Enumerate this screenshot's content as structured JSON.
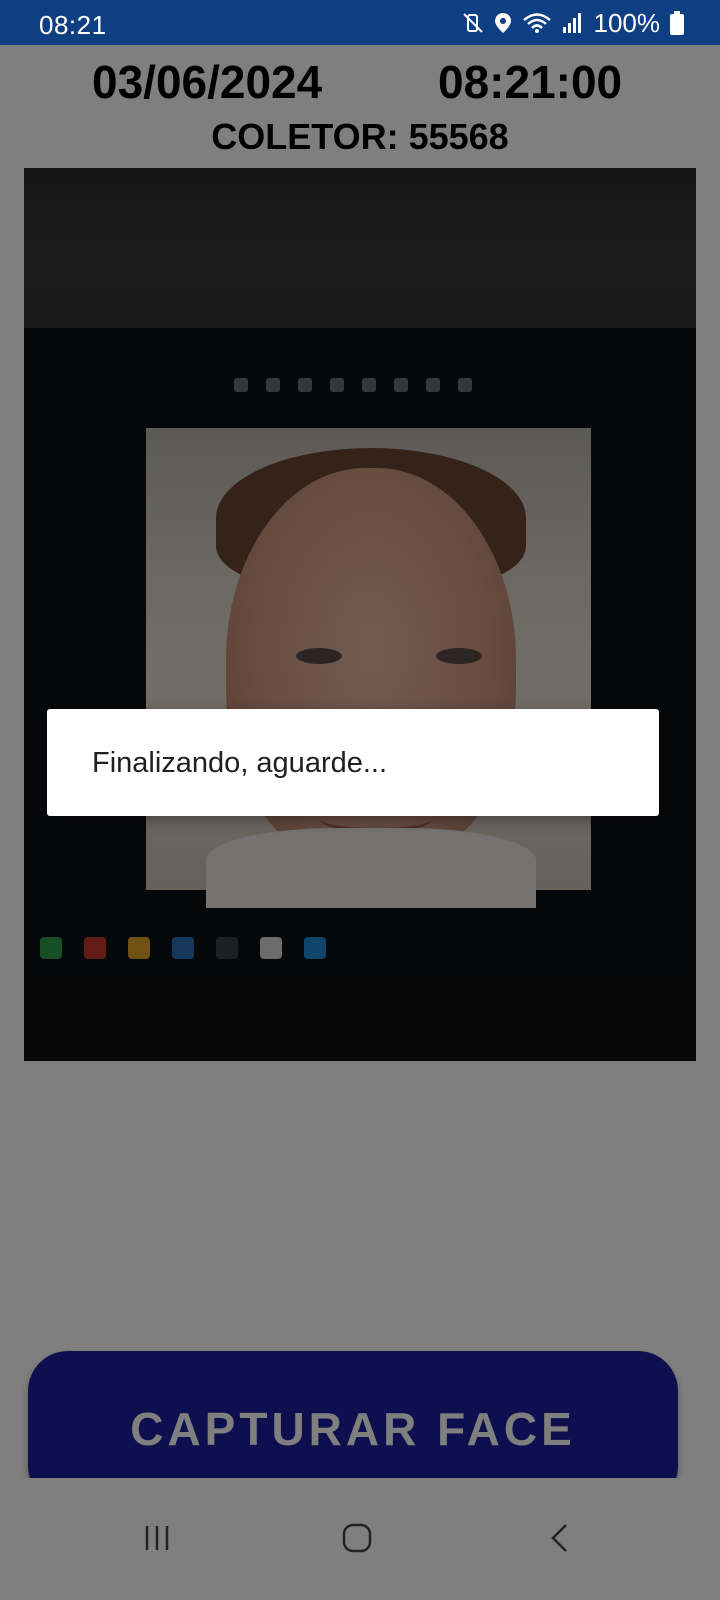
{
  "status_bar": {
    "time": "08:21",
    "battery_percent": "100%",
    "icons": [
      "mute-vibrate-icon",
      "location-icon",
      "wifi-icon",
      "signal-icon",
      "battery-icon"
    ],
    "background_color": "#0d3f82"
  },
  "header": {
    "date": "03/06/2024",
    "time": "08:21:00",
    "collector": "COLETOR: 55568"
  },
  "camera_preview": {
    "content": "camera-feed"
  },
  "action": {
    "capture_label": "CAPTURAR FACE",
    "button_color": "#1a1f9c"
  },
  "dialog": {
    "message": "Finalizando, aguarde..."
  },
  "nav_bar": {
    "icons": [
      "recents-icon",
      "home-icon",
      "back-icon"
    ]
  }
}
